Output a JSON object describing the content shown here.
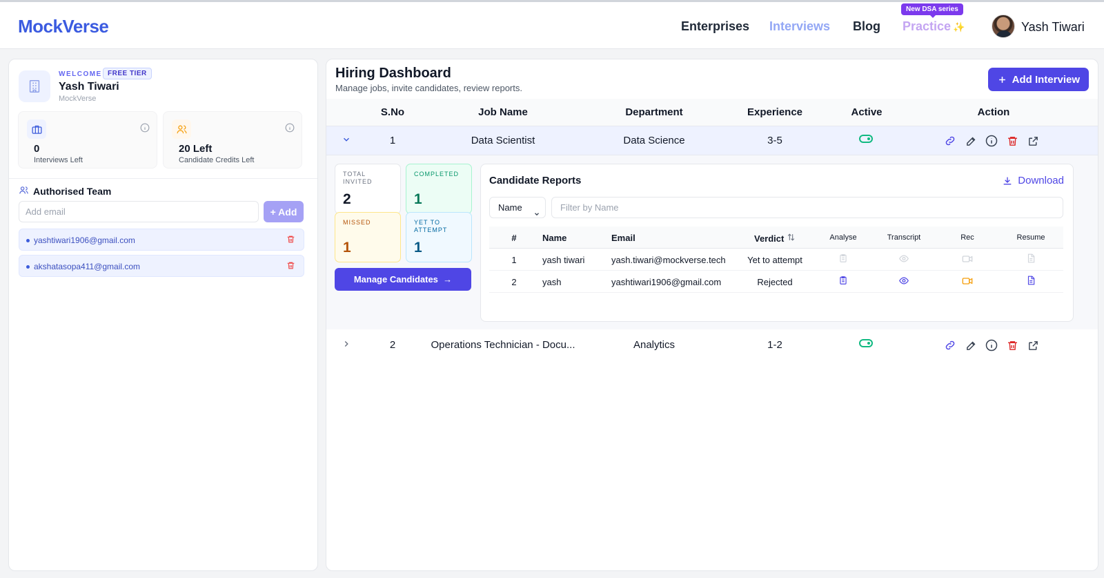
{
  "header": {
    "logo": "MockVerse",
    "nav": [
      "Enterprises",
      "Interviews",
      "Blog",
      "Practice"
    ],
    "practice_badge": "New DSA series",
    "user_name": "Yash Tiwari"
  },
  "sidebar": {
    "welcome": "WELCOME",
    "tier": "FREE TIER",
    "name": "Yash Tiwari",
    "org": "MockVerse",
    "stats": [
      {
        "value": "0",
        "label": "Interviews Left",
        "icon": "briefcase-icon"
      },
      {
        "value": "20 Left",
        "label": "Candidate Credits Left",
        "icon": "users-icon"
      }
    ],
    "team_title": "Authorised Team",
    "email_placeholder": "Add email",
    "add_label": "+ Add",
    "team": [
      "yashtiwari1906@gmail.com",
      "akshatasopa411@gmail.com"
    ]
  },
  "dashboard": {
    "title": "Hiring Dashboard",
    "subtitle": "Manage jobs, invite candidates, review reports.",
    "add_button": "Add Interview",
    "columns": [
      "S.No",
      "Job Name",
      "Department",
      "Experience",
      "Active",
      "Action"
    ],
    "jobs": [
      {
        "sno": "1",
        "name": "Data Scientist",
        "department": "Data Science",
        "experience": "3-5",
        "active": true,
        "expanded": true
      },
      {
        "sno": "2",
        "name": "Operations Technician - Docu...",
        "department": "Analytics",
        "experience": "1-2",
        "active": true,
        "expanded": false
      }
    ],
    "summary": [
      {
        "label": "TOTAL INVITED",
        "value": "2"
      },
      {
        "label": "COMPLETED",
        "value": "1"
      },
      {
        "label": "MISSED",
        "value": "1"
      },
      {
        "label": "YET TO ATTEMPT",
        "value": "1"
      }
    ],
    "manage_button": "Manage Candidates",
    "reports": {
      "title": "Candidate Reports",
      "download": "Download",
      "filter_select": "Name",
      "filter_placeholder": "Filter by Name",
      "columns": [
        "#",
        "Name",
        "Email",
        "Verdict",
        "Analyse",
        "Transcript",
        "Rec",
        "Resume"
      ],
      "rows": [
        {
          "index": "1",
          "name": "yash tiwari",
          "email": "yash.tiwari@mockverse.tech",
          "verdict": "Yet to attempt",
          "enabled": false
        },
        {
          "index": "2",
          "name": "yash",
          "email": "yashtiwari1906@gmail.com",
          "verdict": "Rejected",
          "enabled": true
        }
      ]
    }
  },
  "colors": {
    "brand": "#3b5be0",
    "primary_button": "#4f46e5",
    "active_toggle": "#10b981",
    "delete": "#dc2626"
  }
}
